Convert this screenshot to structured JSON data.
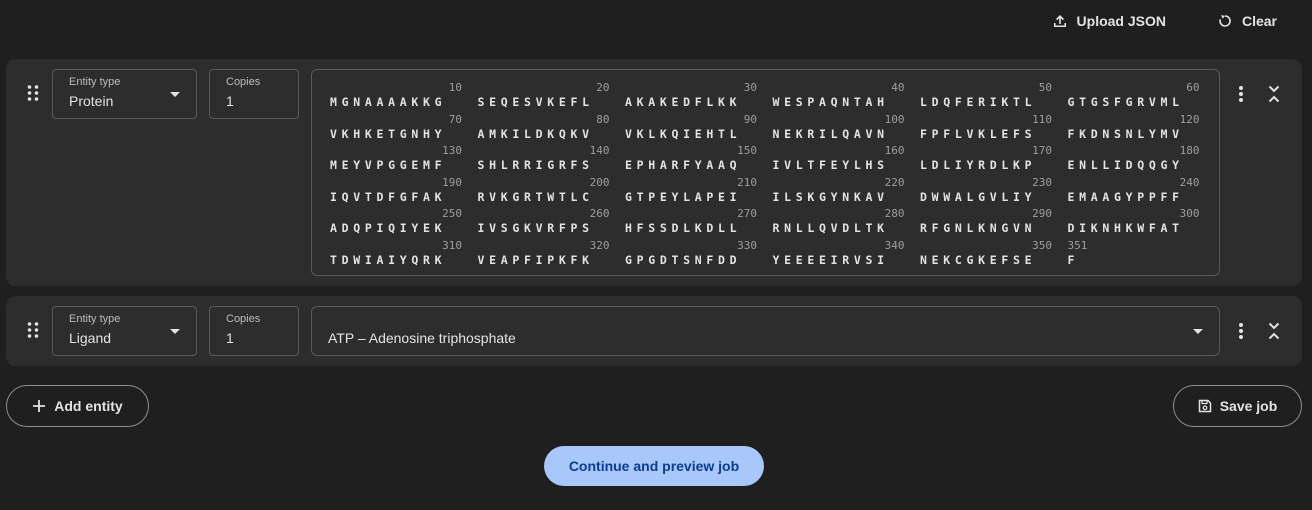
{
  "toolbar": {
    "upload_label": "Upload JSON",
    "clear_label": "Clear"
  },
  "entities": [
    {
      "type_label": "Entity type",
      "type_value": "Protein",
      "copies_label": "Copies",
      "copies_value": "1",
      "sequence_rows": [
        {
          "chunks": [
            {
              "num": "10",
              "seq": "MGNAAAAKKG"
            },
            {
              "num": "20",
              "seq": "SEQESVKEFL"
            },
            {
              "num": "30",
              "seq": "AKAKEDFLKK"
            },
            {
              "num": "40",
              "seq": "WESPAQNTAH"
            },
            {
              "num": "50",
              "seq": "LDQFERIKTL"
            },
            {
              "num": "60",
              "seq": "GTGSFGRVML"
            }
          ]
        },
        {
          "chunks": [
            {
              "num": "70",
              "seq": "VKHKETGNHY"
            },
            {
              "num": "80",
              "seq": "AMKILDKQKV"
            },
            {
              "num": "90",
              "seq": "VKLKQIEHTL"
            },
            {
              "num": "100",
              "seq": "NEKRILQAVN"
            },
            {
              "num": "110",
              "seq": "FPFLVKLEFS"
            },
            {
              "num": "120",
              "seq": "FKDNSNLYMV"
            }
          ]
        },
        {
          "chunks": [
            {
              "num": "130",
              "seq": "MEYVPGGEMF"
            },
            {
              "num": "140",
              "seq": "SHLRRIGRFS"
            },
            {
              "num": "150",
              "seq": "EPHARFYAAQ"
            },
            {
              "num": "160",
              "seq": "IVLTFEYLHS"
            },
            {
              "num": "170",
              "seq": "LDLIYRDLKP"
            },
            {
              "num": "180",
              "seq": "ENLLIDQQGY"
            }
          ]
        },
        {
          "chunks": [
            {
              "num": "190",
              "seq": "IQVTDFGFAK"
            },
            {
              "num": "200",
              "seq": "RVKGRTWTLC"
            },
            {
              "num": "210",
              "seq": "GTPEYLAPEI"
            },
            {
              "num": "220",
              "seq": "ILSKGYNKAV"
            },
            {
              "num": "230",
              "seq": "DWWALGVLIY"
            },
            {
              "num": "240",
              "seq": "EMAAGYPPFF"
            }
          ]
        },
        {
          "chunks": [
            {
              "num": "250",
              "seq": "ADQPIQIYEK"
            },
            {
              "num": "260",
              "seq": "IVSGKVRFPS"
            },
            {
              "num": "270",
              "seq": "HFSSDLKDLL"
            },
            {
              "num": "280",
              "seq": "RNLLQVDLTK"
            },
            {
              "num": "290",
              "seq": "RFGNLKNGVN"
            },
            {
              "num": "300",
              "seq": "DIKNHKWFAT"
            }
          ]
        },
        {
          "chunks": [
            {
              "num": "310",
              "seq": "TDWIAIYQRK"
            },
            {
              "num": "320",
              "seq": "VEAPFIPKFK"
            },
            {
              "num": "330",
              "seq": "GPGDTSNFDD"
            },
            {
              "num": "340",
              "seq": "YEEEEIRVSI"
            },
            {
              "num": "350",
              "seq": "NEKCGKEFSE"
            },
            {
              "num": "351",
              "seq": "F",
              "last": true
            }
          ]
        }
      ]
    },
    {
      "type_label": "Entity type",
      "type_value": "Ligand",
      "copies_label": "Copies",
      "copies_value": "1",
      "ligand_value": "ATP – Adenosine triphosphate"
    }
  ],
  "actions": {
    "add_entity_label": "Add entity",
    "save_job_label": "Save job",
    "continue_label": "Continue and preview job"
  },
  "colors": {
    "background": "#1f1f1f",
    "card": "#2d2d2d",
    "primary_button": "#a8c7fa",
    "primary_text": "#0b3d91"
  }
}
